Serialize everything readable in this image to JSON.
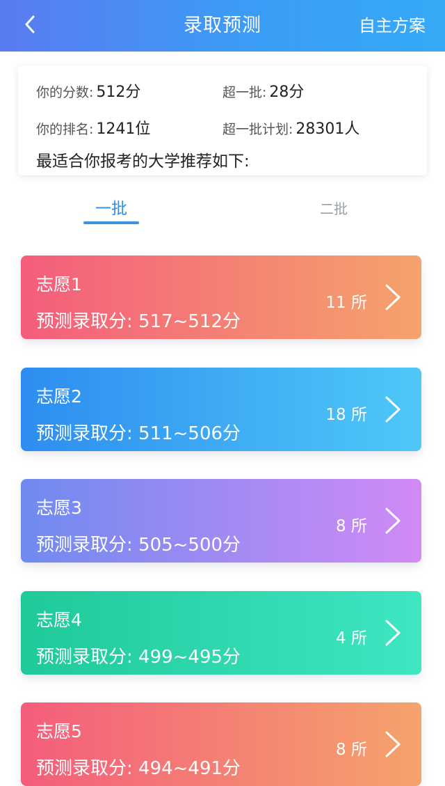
{
  "header": {
    "back_icon": "chevron-left-icon",
    "title": "录取预测",
    "right_action": "自主方案"
  },
  "summary": {
    "score_label": "你的分数:",
    "score_value": "512分",
    "over_label": "超一批:",
    "over_value": "28分",
    "rank_label": "你的排名:",
    "rank_value": "1241位",
    "plan_label": "超一批计划:",
    "plan_value": "28301人",
    "recommend_text": "最适合你报考的大学推荐如下:"
  },
  "tabs": [
    {
      "label": "一批",
      "active": true
    },
    {
      "label": "二批",
      "active": false
    }
  ],
  "choices": [
    {
      "title": "志愿1",
      "range": "预测录取分: 517~512分",
      "count": "11 所",
      "gradient": [
        "#f45d7c",
        "#f5a36c"
      ]
    },
    {
      "title": "志愿2",
      "range": "预测录取分: 511~506分",
      "count": "18 所",
      "gradient": [
        "#2d8df0",
        "#4fc8f8"
      ]
    },
    {
      "title": "志愿3",
      "range": "预测录取分: 505~500分",
      "count": "8 所",
      "gradient": [
        "#6f8af0",
        "#d18af5"
      ]
    },
    {
      "title": "志愿4",
      "range": "预测录取分: 499~495分",
      "count": "4 所",
      "gradient": [
        "#1fc99a",
        "#3ee6c2"
      ]
    },
    {
      "title": "志愿5",
      "range": "预测录取分: 494~491分",
      "count": "8 所",
      "gradient": [
        "#f45d7c",
        "#f5a36c"
      ]
    }
  ],
  "colors": {
    "header_gradient_start": "#5a7bf0",
    "header_gradient_end": "#35a9f6",
    "tab_active": "#2e8ee0",
    "tab_inactive": "#9aa0a8"
  }
}
